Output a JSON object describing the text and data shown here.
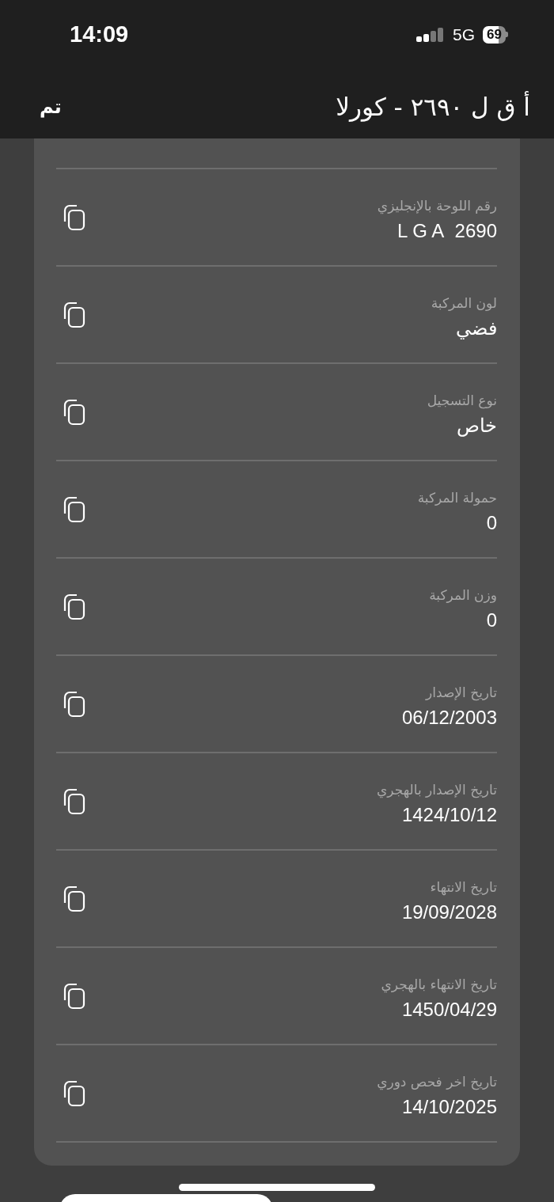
{
  "status_bar": {
    "time": "14:09",
    "network": "5G",
    "battery": "69"
  },
  "header": {
    "title": "أ ق ل ٢٦٩٠ - كورلا",
    "done": "تم"
  },
  "fields": [
    {
      "label": "رقم اللوحة بالإنجليزي",
      "value": "2690  L G A"
    },
    {
      "label": "لون المركبة",
      "value": "فضي"
    },
    {
      "label": "نوع التسجيل",
      "value": "خاص"
    },
    {
      "label": "حمولة المركبة",
      "value": "0"
    },
    {
      "label": "وزن المركبة",
      "value": "0"
    },
    {
      "label": "تاريخ الإصدار",
      "value": "06/12/2003"
    },
    {
      "label": "تاريخ الإصدار بالهجري",
      "value": "1424/10/12"
    },
    {
      "label": "تاريخ الانتهاء",
      "value": "19/09/2028"
    },
    {
      "label": "تاريخ الانتهاء بالهجري",
      "value": "1450/04/29"
    },
    {
      "label": "تاريخ اخر فحص دوري",
      "value": "14/10/2025"
    }
  ]
}
